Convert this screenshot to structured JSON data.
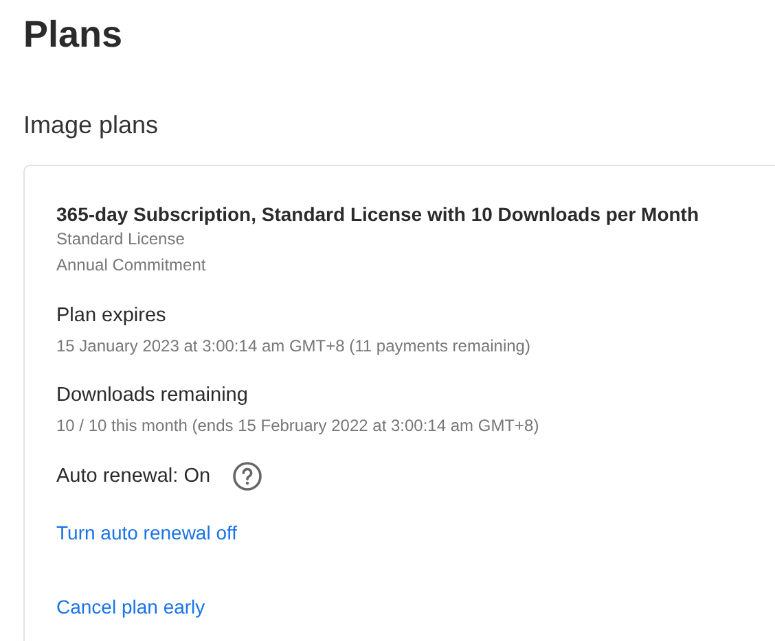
{
  "page_title": "Plans",
  "section_title": "Image plans",
  "plan": {
    "name": "365-day Subscription, Standard License with 10 Downloads per Month",
    "details": [
      "Standard License",
      "Annual Commitment"
    ],
    "facts": [
      {
        "label": "Plan expires",
        "value": "15 January 2023 at 3:00:14 am GMT+8 (11 payments remaining)"
      },
      {
        "label": "Downloads remaining",
        "value": "10 / 10 this month (ends 15 February 2022 at 3:00:14 am GMT+8)"
      }
    ],
    "auto_renewal": {
      "label": "Auto renewal: On"
    },
    "links": [
      "Turn auto renewal off",
      "Cancel plan early"
    ]
  }
}
